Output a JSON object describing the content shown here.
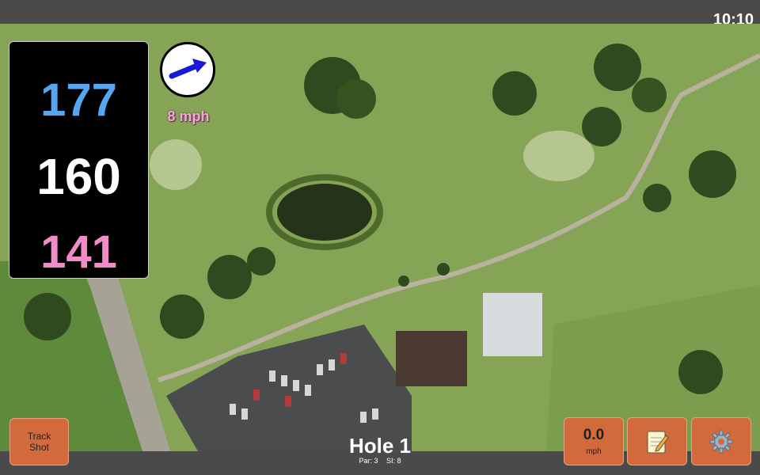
{
  "status": {
    "time": "10:10"
  },
  "distances": {
    "back": "177",
    "center": "160",
    "front": "141"
  },
  "wind": {
    "speed": "8 mph",
    "icon": "arrow-icon"
  },
  "buttons": {
    "track_shot_line1": "Track",
    "track_shot_line2": "Shot",
    "speed_value": "0.0",
    "speed_unit": "mph",
    "notes_icon": "notepad-icon",
    "settings_icon": "gear-icon"
  },
  "hole": {
    "title": "Hole 1",
    "par": "Par: 3",
    "si": "SI: 8"
  },
  "colors": {
    "back": "#55a6f2",
    "center": "#ffffff",
    "front": "#f28cc8",
    "button": "#d26a3c"
  }
}
